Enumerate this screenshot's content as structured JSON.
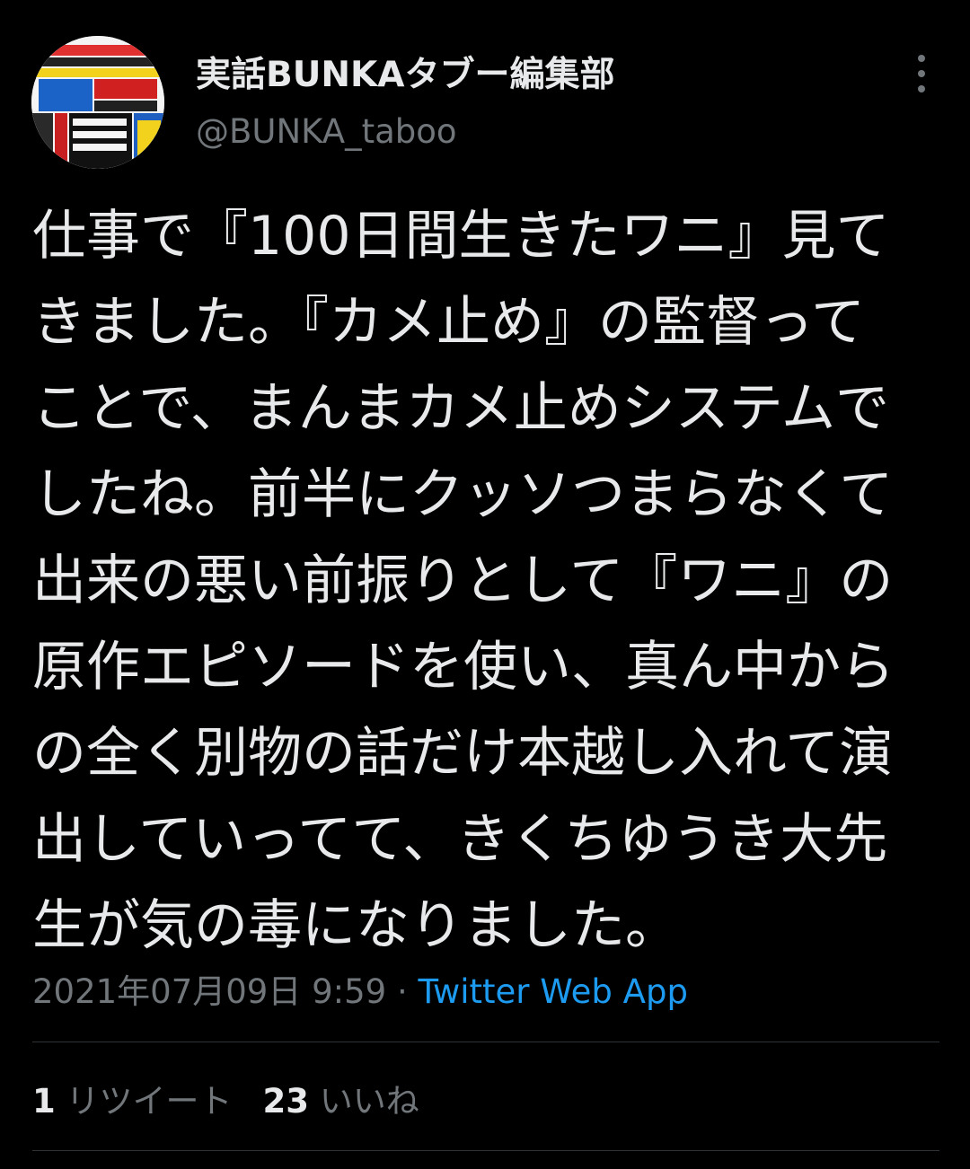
{
  "author": {
    "display_name": "実話BUNKAタブー編集部",
    "handle": "@BUNKA_taboo",
    "avatar_icon": "magazine-cover-avatar"
  },
  "tweet": {
    "text": "仕事で『100日間生きたワニ』見て\nきました。『カメ止め』の監督って\nことで、まんまカメ止めシステムで\nしたね。前半にクッソつまらなくて\n出来の悪い前振りとして『ワニ』の\n原作エピソードを使い、真ん中から\nの全く別物の話だけ本越し入れて演\n出していってて、きくちゆうき大先\n生が気の毒になりました。",
    "timestamp": "2021年07月09日 9:59",
    "separator": "·",
    "source": "Twitter Web App"
  },
  "stats": {
    "retweet_count": "1",
    "retweet_label": "リツイート",
    "like_count": "23",
    "like_label": "いいね"
  },
  "colors": {
    "background": "#000000",
    "primary_text": "#e7e9ea",
    "secondary_text": "#71767b",
    "link": "#1d9bf0",
    "divider": "#2f3336"
  },
  "icons": {
    "more": "more-vertical-icon"
  }
}
